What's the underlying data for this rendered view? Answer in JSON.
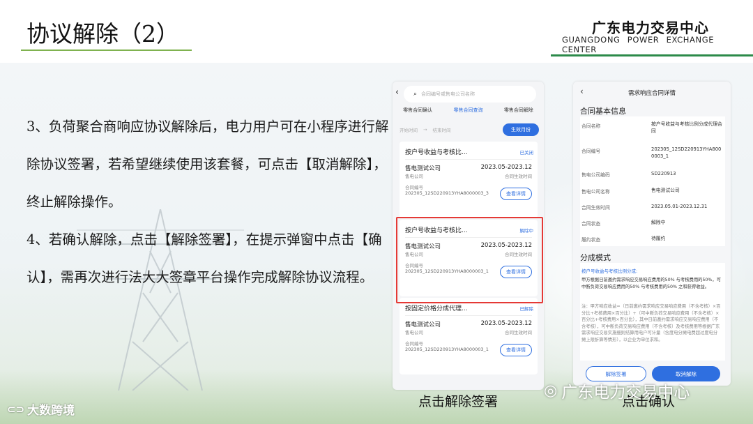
{
  "header": {
    "title": "协议解除（2）",
    "org_cn": "广东电力交易中心",
    "org_en": "GUANGDONG POWER EXCHANGE CENTER"
  },
  "body": {
    "paragraph1": "3、负荷聚合商响应协议解除后，电力用户可在小程序进行解除协议签署，若希望继续使用该套餐，可点击【取消解除】，终止解除操作。",
    "paragraph2": "4、若确认解除，点击【解除签署】，在提示弹窗中点击【确认】，需再次进行法大大签章平台操作完成解除协议流程。"
  },
  "phone1": {
    "search_placeholder": "合同编号或售电公司名称",
    "tabs": [
      "零售合同确认",
      "零售合同查询",
      "零售合同解除"
    ],
    "date_start": "开始时间",
    "date_arrow": "→",
    "date_end": "结束时间",
    "effective_month": "生效月份",
    "cards": [
      {
        "title": "按户号收益与考核比...",
        "status": "已关闭",
        "company": "售电测试公司",
        "company_sub": "售电公司",
        "period": "2023.05-2023.12",
        "period_sub": "合同生效时间",
        "no_label": "合同编号",
        "no": "202305_12SD220913YHA8000003_3",
        "detail": "查看详情"
      },
      {
        "title": "按户号收益与考核比...",
        "status": "解除中",
        "company": "售电测试公司",
        "company_sub": "售电公司",
        "period": "2023.05-2023.12",
        "period_sub": "合同生效时间",
        "no_label": "合同编号",
        "no": "202305_12SD220913YHA8000003_1",
        "detail": "查看详情"
      },
      {
        "title": "按固定价格分成代理...",
        "status": "已解除",
        "company": "售电测试公司",
        "company_sub": "售电公司",
        "period": "2023.05-2023.12",
        "period_sub": "合同生效时间",
        "no_label": "合同编号",
        "no": "202305_12SD220913YHA8000003_1",
        "detail": "查看详情"
      }
    ]
  },
  "phone2": {
    "title": "需求响应合同详情",
    "section_basic": "合同基本信息",
    "fields": [
      {
        "k": "合同名称",
        "v": "按户号收益与考核比例分成代理合同"
      },
      {
        "k": "合同编号",
        "v": "202305_12SD220913YHA8000003_1"
      },
      {
        "k": "售电公司编码",
        "v": "SD220913"
      },
      {
        "k": "售电公司名称",
        "v": "售电测试公司"
      },
      {
        "k": "合同生效时间",
        "v": "2023.05.01-2023.12.31"
      },
      {
        "k": "合同状态",
        "v": "解除中"
      },
      {
        "k": "履约状态",
        "v": "待履约"
      }
    ],
    "section_mode": "分成模式",
    "mode_title": "按户号收益与考核比例分成:",
    "mode_text": "甲方根据日前邀约需求响应交易响应费用的50% 与考核费用的50%，可中断负荷交易响应费用的50% 与考核费用的50% 之和获得收益。",
    "note": "注：甲方响应收益=（日前邀约需求响应交易响应费用（不含考核）×百分比+考核费用×百分比）+（可中断负荷交易响应费用（不含考核）×百分比+考核费用×百分比），其中日前邀约需求响应交易响应费用（不含考核），可中断负荷交易响应费用（不含考核）及考核费用等根据广东需求响应交易实施细则结算用电户可计量（含度电分摊电费超过度电分摊上限折算等情形），以企业为单位求和。",
    "btn_sign": "解除签署",
    "btn_cancel": "取消解除"
  },
  "captions": {
    "left": "点击解除签署",
    "right": "点击确认"
  },
  "watermarks": {
    "left": "大数跨境",
    "right": "广东电力交易中心"
  },
  "colors": {
    "accent": "#2f6fe0",
    "highlight": "#e53935",
    "title_underline": "#7fb24f",
    "org_line": "#2c8a4a"
  }
}
